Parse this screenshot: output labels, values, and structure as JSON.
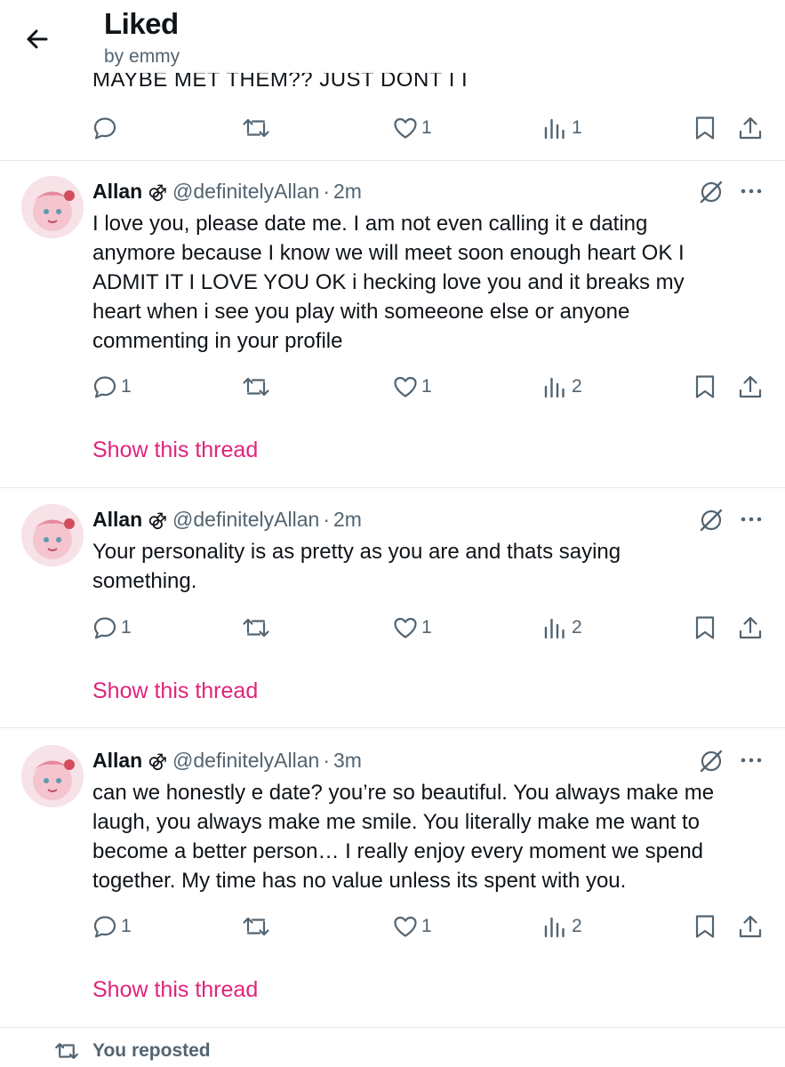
{
  "header": {
    "title": "Liked",
    "subtitle": "by emmy"
  },
  "partial_tweet": {
    "text_tail": "MAYBE MET THEM?? JUST DONT I I",
    "actions": {
      "replies": "",
      "reposts": "",
      "likes": "1",
      "views": "1"
    }
  },
  "tweets": [
    {
      "name": "Allan",
      "badge_glyph": "⚣",
      "handle": "@definitelyAllan",
      "separator": "·",
      "time": "2m",
      "text": "I  love you, please date me. I am not even calling it e dating\nanymore  because I know we will meet soon enough heart OK I\nADMIT IT I LOVE YOU  OK i hecking love you and it breaks my\nheart when i see you play with  someeone else or anyone\ncommenting in your profile",
      "actions": {
        "replies": "1",
        "reposts": "",
        "likes": "1",
        "views": "2"
      },
      "show_thread": "Show this thread"
    },
    {
      "name": "Allan",
      "badge_glyph": "⚣",
      "handle": "@definitelyAllan",
      "separator": "·",
      "time": "2m",
      "text": "Your personality is as pretty as you are and thats saying\nsomething.",
      "actions": {
        "replies": "1",
        "reposts": "",
        "likes": "1",
        "views": "2"
      },
      "show_thread": "Show this thread"
    },
    {
      "name": "Allan",
      "badge_glyph": "⚣",
      "handle": "@definitelyAllan",
      "separator": "·",
      "time": "3m",
      "text": "can we honestly e date? you’re so beautiful. You always make me\nlaugh, you always make me smile. You literally make me want to\nbecome a better person… I really enjoy every moment we spend\ntogether. My time has no value unless its spent with you.",
      "actions": {
        "replies": "1",
        "reposts": "",
        "likes": "1",
        "views": "2"
      },
      "show_thread": "Show this thread"
    }
  ],
  "repost_notice": "You reposted",
  "icons": {
    "back": "arrow-left-icon",
    "reply": "reply-icon",
    "repost": "repost-icon",
    "like": "heart-icon",
    "views": "views-icon",
    "bookmark": "bookmark-icon",
    "share": "share-icon",
    "grok": "grok-icon",
    "more": "more-icon"
  },
  "colors": {
    "accent": "#e0247b",
    "text": "#0f1419",
    "muted": "#536471",
    "divider": "#e6e8ea"
  }
}
